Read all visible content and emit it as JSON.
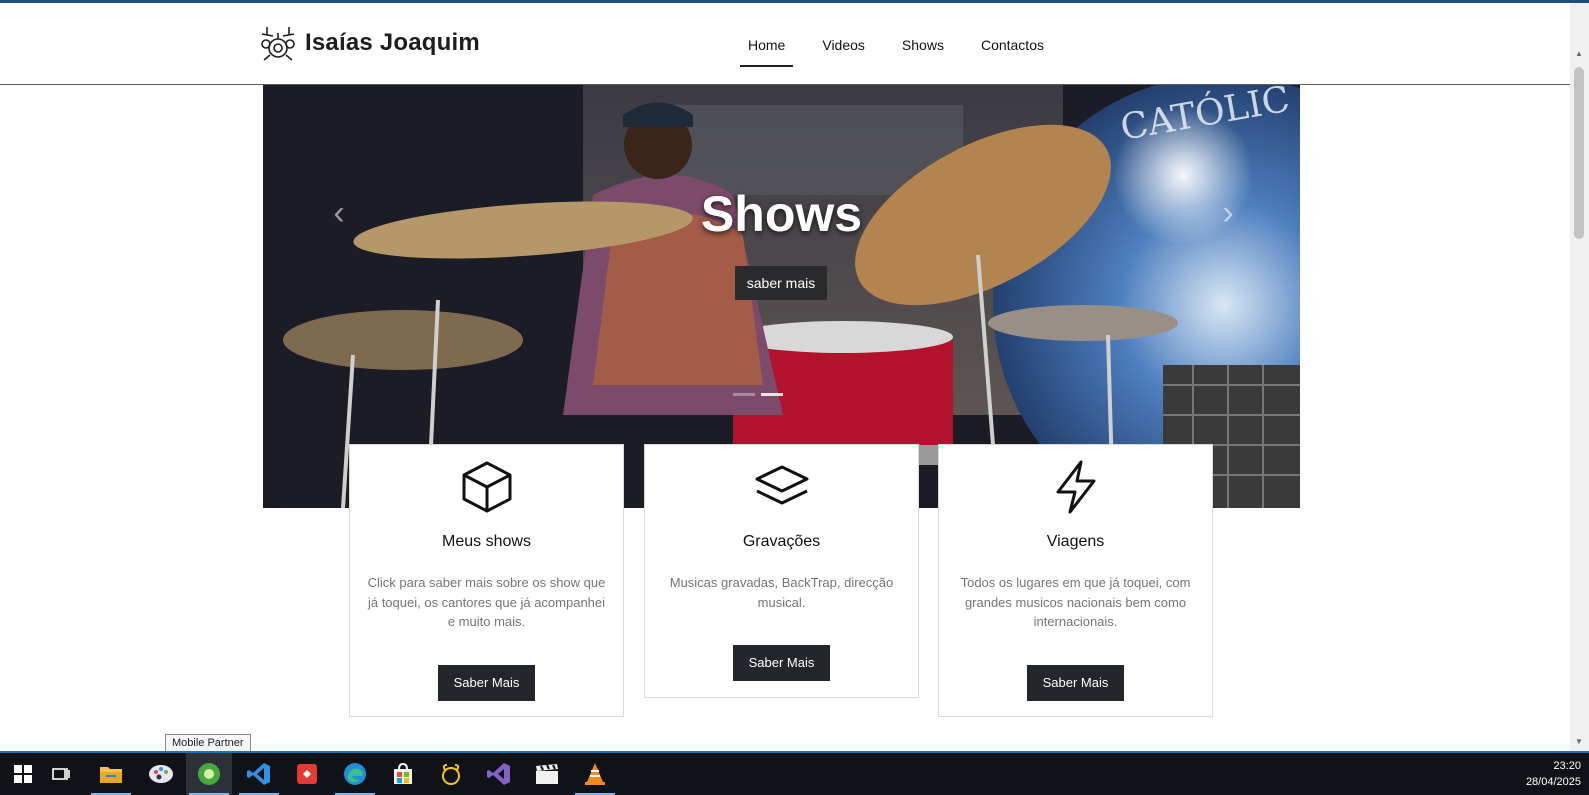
{
  "brand": {
    "name": "Isaías Joaquim",
    "logo_icon": "drum-kit-icon"
  },
  "nav": {
    "links": [
      {
        "label": "Home",
        "active": true
      },
      {
        "label": "Videos",
        "active": false
      },
      {
        "label": "Shows",
        "active": false
      },
      {
        "label": "Contactos",
        "active": false
      }
    ]
  },
  "hero": {
    "title": "Shows",
    "button_label": "saber mais",
    "prev_icon": "chevron-left-icon",
    "next_icon": "chevron-right-icon",
    "slide_count": 2,
    "active_slide": 1,
    "background_text": "CATÓLIC"
  },
  "cards": [
    {
      "icon": "cube-icon",
      "title": "Meus shows",
      "text": "Click para saber mais sobre os show que já toquei, os cantores que já acompanhei e muito mais.",
      "button_label": "Saber Mais"
    },
    {
      "icon": "layers-icon",
      "title": "Gravações",
      "text": "Musicas gravadas, BackTrap, direcção musical.",
      "button_label": "Saber Mais"
    },
    {
      "icon": "lightning-icon",
      "title": "Viagens",
      "text": "Todos os lugares em que já toquei, com grandes musicos nacionais bem como internacionais.",
      "button_label": "Saber Mais"
    }
  ],
  "tooltip": {
    "text": "Mobile Partner"
  },
  "taskbar": {
    "items": [
      {
        "name": "start-icon"
      },
      {
        "name": "task-view-icon"
      },
      {
        "name": "file-explorer-icon"
      },
      {
        "name": "paint-icon"
      },
      {
        "name": "mobile-partner-icon"
      },
      {
        "name": "vscode-icon"
      },
      {
        "name": "git-icon"
      },
      {
        "name": "edge-icon"
      },
      {
        "name": "store-icon"
      },
      {
        "name": "app-icon"
      },
      {
        "name": "visual-studio-icon"
      },
      {
        "name": "clapperboard-icon"
      },
      {
        "name": "vlc-icon"
      }
    ],
    "time": "23:20",
    "date": "28/04/2025"
  },
  "colors": {
    "accent": "#1f4f7a",
    "dark_button": "#23262b",
    "card_text": "#757575",
    "taskbar_bg": "#0f1216"
  }
}
